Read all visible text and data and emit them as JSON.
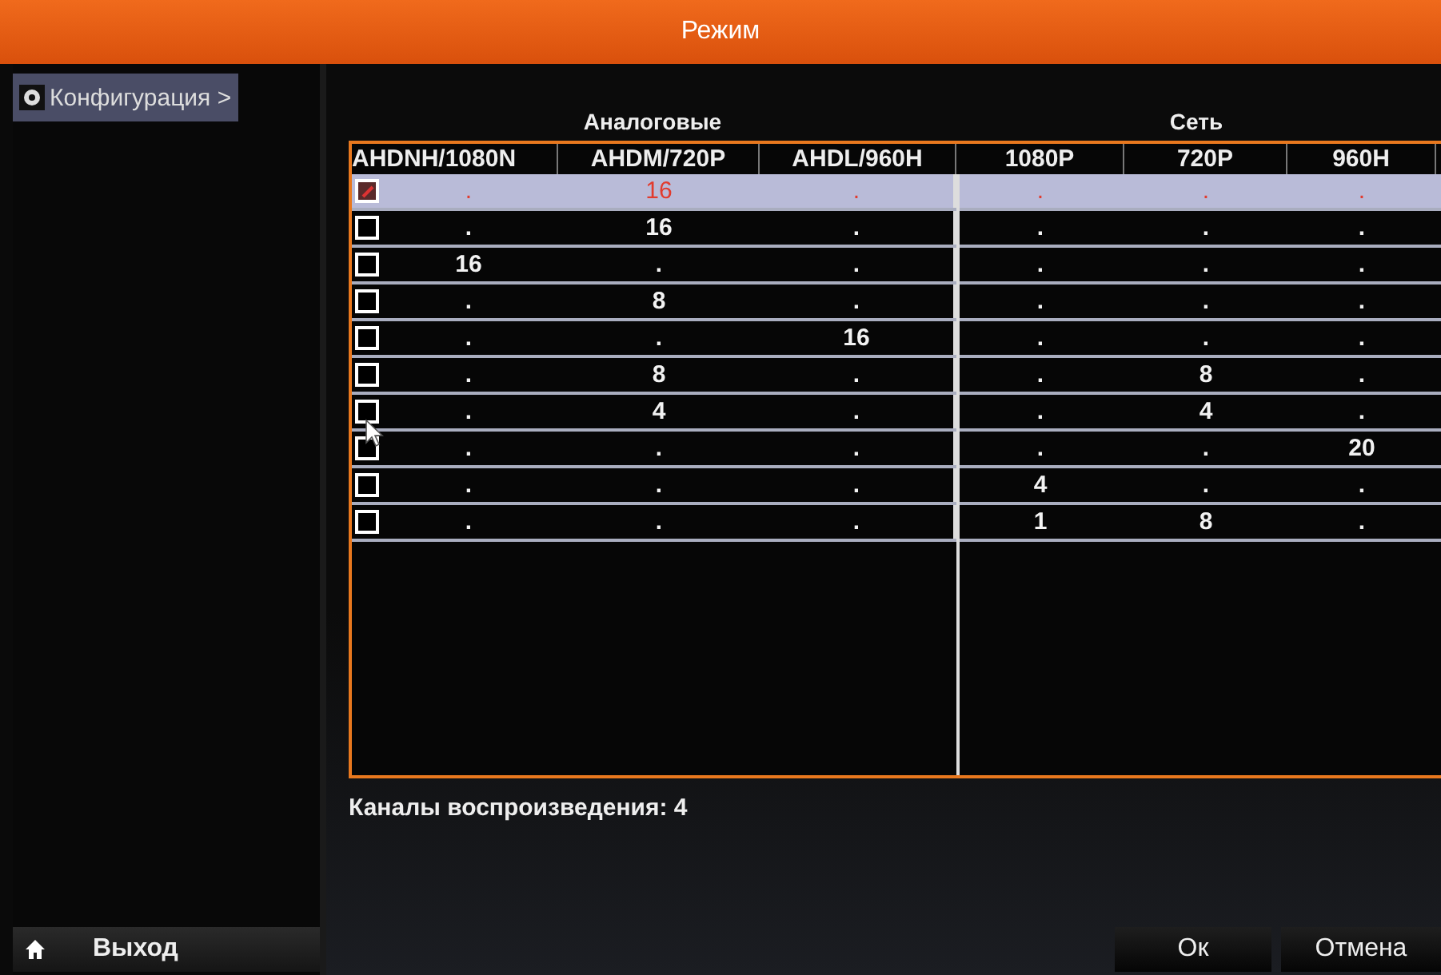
{
  "window": {
    "title": "Режим"
  },
  "sidebar": {
    "items": [
      {
        "label": "Конфигурация >",
        "selected": true
      }
    ],
    "exit_button": "Выход"
  },
  "groups": [
    "Аналоговые",
    "Сеть"
  ],
  "columns": [
    "AHDNH/1080N",
    "AHDM/720P",
    "AHDL/960H",
    "1080P",
    "720P",
    "960H"
  ],
  "rows": [
    {
      "checked": true,
      "selected": true,
      "cells": [
        ".",
        "16",
        ".",
        ".",
        ".",
        "."
      ]
    },
    {
      "checked": false,
      "selected": false,
      "cells": [
        ".",
        "16",
        ".",
        ".",
        ".",
        "."
      ]
    },
    {
      "checked": false,
      "selected": false,
      "cells": [
        "16",
        ".",
        ".",
        ".",
        ".",
        "."
      ]
    },
    {
      "checked": false,
      "selected": false,
      "cells": [
        ".",
        "8",
        ".",
        ".",
        ".",
        "."
      ]
    },
    {
      "checked": false,
      "selected": false,
      "cells": [
        ".",
        ".",
        "16",
        ".",
        ".",
        "."
      ]
    },
    {
      "checked": false,
      "selected": false,
      "cells": [
        ".",
        "8",
        ".",
        ".",
        "8",
        "."
      ]
    },
    {
      "checked": false,
      "selected": false,
      "cells": [
        ".",
        "4",
        ".",
        ".",
        "4",
        "."
      ]
    },
    {
      "checked": false,
      "selected": false,
      "cells": [
        ".",
        ".",
        ".",
        ".",
        ".",
        "20"
      ]
    },
    {
      "checked": false,
      "selected": false,
      "cells": [
        ".",
        ".",
        ".",
        "4",
        ".",
        "."
      ]
    },
    {
      "checked": false,
      "selected": false,
      "cells": [
        ".",
        ".",
        ".",
        "1",
        "8",
        "."
      ]
    }
  ],
  "playback_channels": "Каналы воспроизведения: 4",
  "buttons": [
    "Ок",
    "Отмена"
  ]
}
